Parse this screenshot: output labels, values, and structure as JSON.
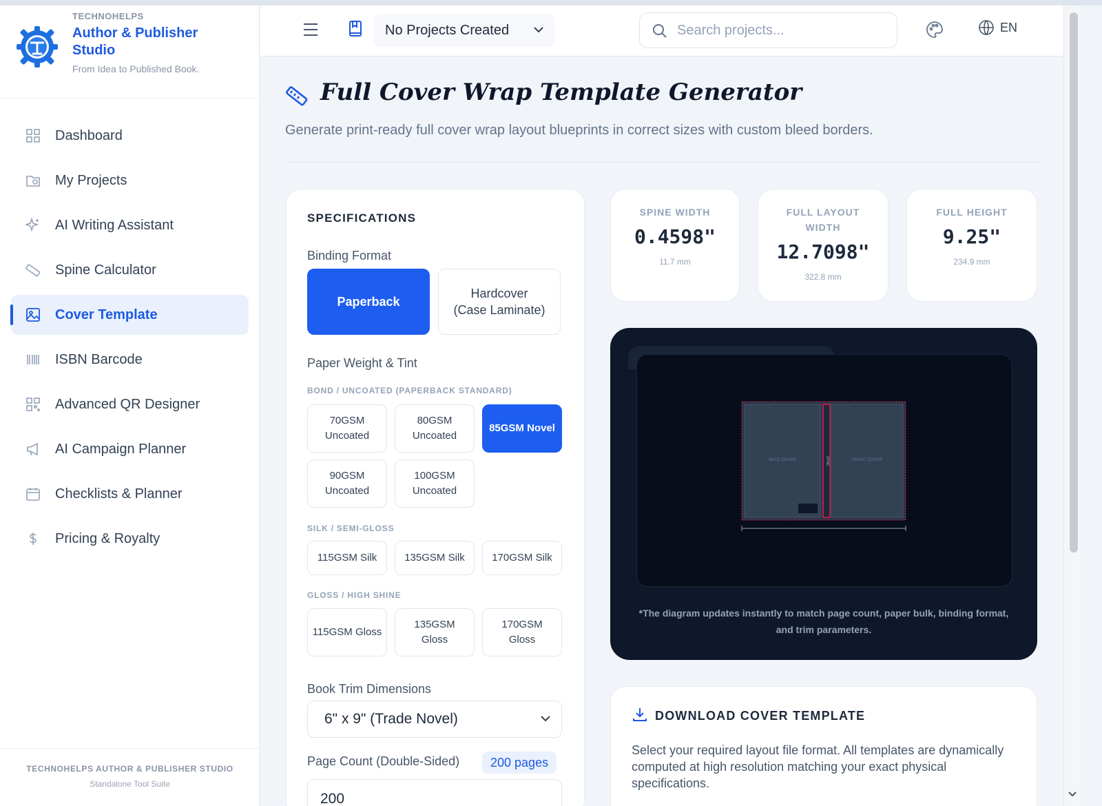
{
  "brand": {
    "top": "TECHNOHELPS",
    "name": "Author & Publisher Studio",
    "tagline": "From Idea to Published Book."
  },
  "nav": {
    "items": [
      {
        "label": "Dashboard",
        "icon": "dashboard-icon"
      },
      {
        "label": "My Projects",
        "icon": "projects-icon"
      },
      {
        "label": "AI Writing Assistant",
        "icon": "sparkle-icon"
      },
      {
        "label": "Spine Calculator",
        "icon": "ruler-icon"
      },
      {
        "label": "Cover Template",
        "icon": "image-icon",
        "active": true
      },
      {
        "label": "ISBN Barcode",
        "icon": "barcode-icon"
      },
      {
        "label": "Advanced QR Designer",
        "icon": "qr-icon"
      },
      {
        "label": "AI Campaign Planner",
        "icon": "megaphone-icon"
      },
      {
        "label": "Checklists & Planner",
        "icon": "calendar-icon"
      },
      {
        "label": "Pricing & Royalty",
        "icon": "dollar-icon"
      }
    ]
  },
  "footer": {
    "line1": "TECHNOHELPS AUTHOR & PUBLISHER STUDIO",
    "line2": "Standalone Tool Suite"
  },
  "topbar": {
    "project_select": "No Projects Created",
    "search_placeholder": "Search projects...",
    "language": "EN"
  },
  "page": {
    "title": "Full Cover Wrap Template Generator",
    "subtitle": "Generate print-ready full cover wrap layout blueprints in correct sizes with custom bleed borders."
  },
  "specs": {
    "heading": "SPECIFICATIONS",
    "binding_label": "Binding Format",
    "binding_options": [
      {
        "label": "Paperback",
        "selected": true
      },
      {
        "label": "Hardcover (Case Laminate)",
        "selected": false
      }
    ],
    "paper_label": "Paper Weight & Tint",
    "groups": [
      {
        "name": "BOND / UNCOATED (PAPERBACK STANDARD)",
        "options": [
          "70GSM Uncoated",
          "80GSM Uncoated",
          "85GSM Novel",
          "90GSM Uncoated",
          "100GSM Uncoated"
        ],
        "selected": "85GSM Novel"
      },
      {
        "name": "SILK / SEMI-GLOSS",
        "options": [
          "115GSM Silk",
          "135GSM Silk",
          "170GSM Silk"
        ]
      },
      {
        "name": "GLOSS / HIGH SHINE",
        "options": [
          "115GSM Gloss",
          "135GSM Gloss",
          "170GSM Gloss"
        ]
      }
    ],
    "trim_label": "Book Trim Dimensions",
    "trim_value": "6\" x 9\" (Trade Novel)",
    "page_count_label": "Page Count (Double-Sided)",
    "page_count_badge": "200 pages",
    "page_count_value": "200"
  },
  "stats": [
    {
      "label": "SPINE WIDTH",
      "value": "0.4598\"",
      "mm": "11.7 mm"
    },
    {
      "label": "FULL LAYOUT WIDTH",
      "value": "12.7098\"",
      "mm": "322.8 mm"
    },
    {
      "label": "FULL HEIGHT",
      "value": "9.25\"",
      "mm": "234.9 mm"
    }
  ],
  "preview": {
    "back_label": "BACK COVER",
    "front_label": "FRONT COVER",
    "spine_label": "SPINE",
    "note": "*The diagram updates instantly to match page count, paper bulk, binding format, and trim parameters."
  },
  "download": {
    "heading": "DOWNLOAD COVER TEMPLATE",
    "text": "Select your required layout file format. All templates are dynamically computed at high resolution matching your exact physical specifications."
  },
  "colors": {
    "accent": "#1d5ef0",
    "preview_bg": "#0f172a",
    "bleed_line": "#e11d48"
  }
}
